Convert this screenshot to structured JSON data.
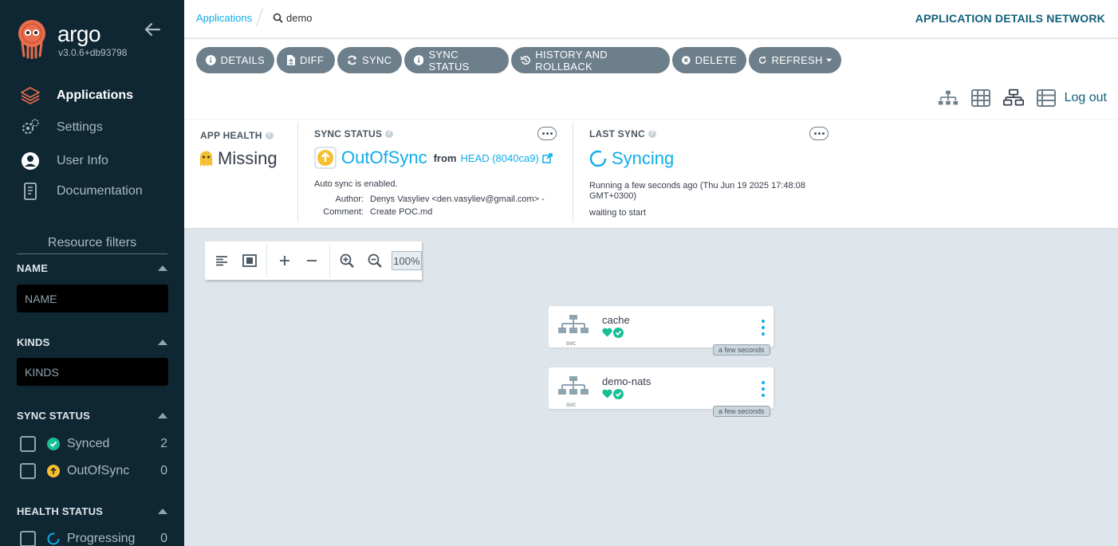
{
  "sidebar": {
    "brand": "argo",
    "version": "v3.0.6+db93798",
    "nav": [
      {
        "label": "Applications",
        "icon": "layers-icon",
        "active": true
      },
      {
        "label": "Settings",
        "icon": "gears-icon"
      },
      {
        "label": "User Info",
        "icon": "user-circle-icon"
      },
      {
        "label": "Documentation",
        "icon": "book-icon"
      }
    ],
    "filters_title": "Resource filters",
    "name_label": "NAME",
    "name_placeholder": "NAME",
    "kinds_label": "KINDS",
    "kinds_placeholder": "KINDS",
    "sync_status_label": "SYNC STATUS",
    "sync_items": [
      {
        "label": "Synced",
        "count": "2"
      },
      {
        "label": "OutOfSync",
        "count": "0"
      }
    ],
    "health_status_label": "HEALTH STATUS",
    "health_items": [
      {
        "label": "Progressing",
        "count": "0"
      }
    ]
  },
  "topbar": {
    "breadcrumb_root": "Applications",
    "breadcrumb_current": "demo",
    "page_title": "APPLICATION DETAILS NETWORK"
  },
  "toolbar": {
    "buttons": [
      "DETAILS",
      "DIFF",
      "SYNC",
      "SYNC STATUS",
      "HISTORY AND ROLLBACK",
      "DELETE",
      "REFRESH"
    ],
    "logout": "Log out"
  },
  "status": {
    "app_health_label": "APP HEALTH",
    "app_health_value": "Missing",
    "sync_status_label": "SYNC STATUS",
    "sync_status_value": "OutOfSync",
    "from_label": "from",
    "revision": "HEAD (8040ca9)",
    "auto_sync": "Auto sync is enabled.",
    "author_label": "Author:",
    "author_value": "Denys Vasyliev <den.vasyliev@gmail.com> -",
    "comment_label": "Comment:",
    "comment_value": "Create POC.md",
    "last_sync_label": "LAST SYNC",
    "last_sync_value": "Syncing",
    "running_line1": "Running a few seconds ago (Thu Jun 19 2025 17:48:08",
    "running_line2": "GMT+0300)",
    "waiting": "waiting to start"
  },
  "graph": {
    "zoom_level": "100%",
    "nodes": [
      {
        "name": "cache",
        "kind": "svc",
        "age": "a few seconds"
      },
      {
        "name": "demo-nats",
        "kind": "svc",
        "age": "a few seconds"
      }
    ]
  },
  "colors": {
    "sidebar_bg": "#0f2733",
    "accent": "#0dadea",
    "healthy": "#18be94",
    "out_of_sync": "#f4c030",
    "button_bg": "#6d7f8b",
    "graph_bg": "#dee6eb"
  }
}
